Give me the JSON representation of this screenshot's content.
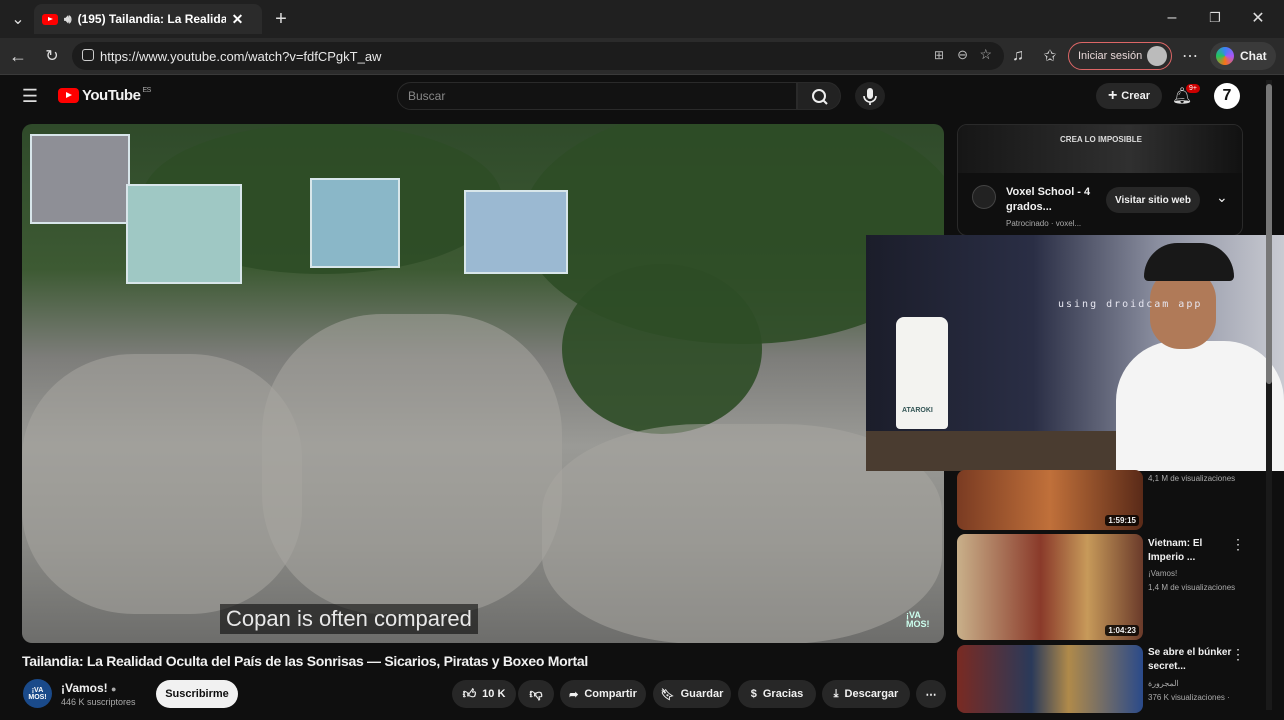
{
  "browser": {
    "tab_title": "(195) Tailandia: La Realidad Ocu",
    "url": "https://www.youtube.com/watch?v=fdfCPgkT_aw",
    "signin_label": "Iniciar sesión",
    "chat_label": "Chat"
  },
  "header": {
    "logo_text": "YouTube",
    "region": "ES",
    "search_placeholder": "Buscar",
    "create_label": "Crear",
    "notif_count": "9+"
  },
  "video": {
    "subtitle": "Copan is often compared",
    "watermark": "¡VA MOS!",
    "title": "Tailandia: La Realidad Oculta del País de las Sonrisas — Sicarios, Piratas y Boxeo Mortal",
    "channel": "¡Vamos!",
    "channel_avatar_text": "¡VA MOS!",
    "subscribers": "446 K suscriptores",
    "subscribe_label": "Suscribirme",
    "likes": "10 K",
    "share_label": "Compartir",
    "save_label": "Guardar",
    "thanks_label": "Gracias",
    "download_label": "Descargar"
  },
  "ad": {
    "banner_text": "CREA LO IMPOSIBLE",
    "title": "Voxel School - 4 grados...",
    "sponsored": "Patrocinado · voxel...",
    "visit_label": "Visitar sitio web"
  },
  "pip": {
    "overlay_text": "using droidcam app",
    "bottle_label": "ATAROKI"
  },
  "recommendations": [
    {
      "title": "",
      "channel": "",
      "views": "4,1 M de visualizaciones",
      "duration": "1:59:15"
    },
    {
      "title": "Vietnam: El Imperio ...",
      "channel": "¡Vamos!",
      "views": "1,4 M de visualizaciones",
      "duration": "1:04:23"
    },
    {
      "title": "Se abre el búnker secret...",
      "channel": "المجرورة",
      "views": "376 K visualizaciones ·",
      "duration": ""
    }
  ],
  "colors": {
    "brand_red": "#ff0000",
    "background": "#0f0f0f",
    "pill": "#272727"
  }
}
